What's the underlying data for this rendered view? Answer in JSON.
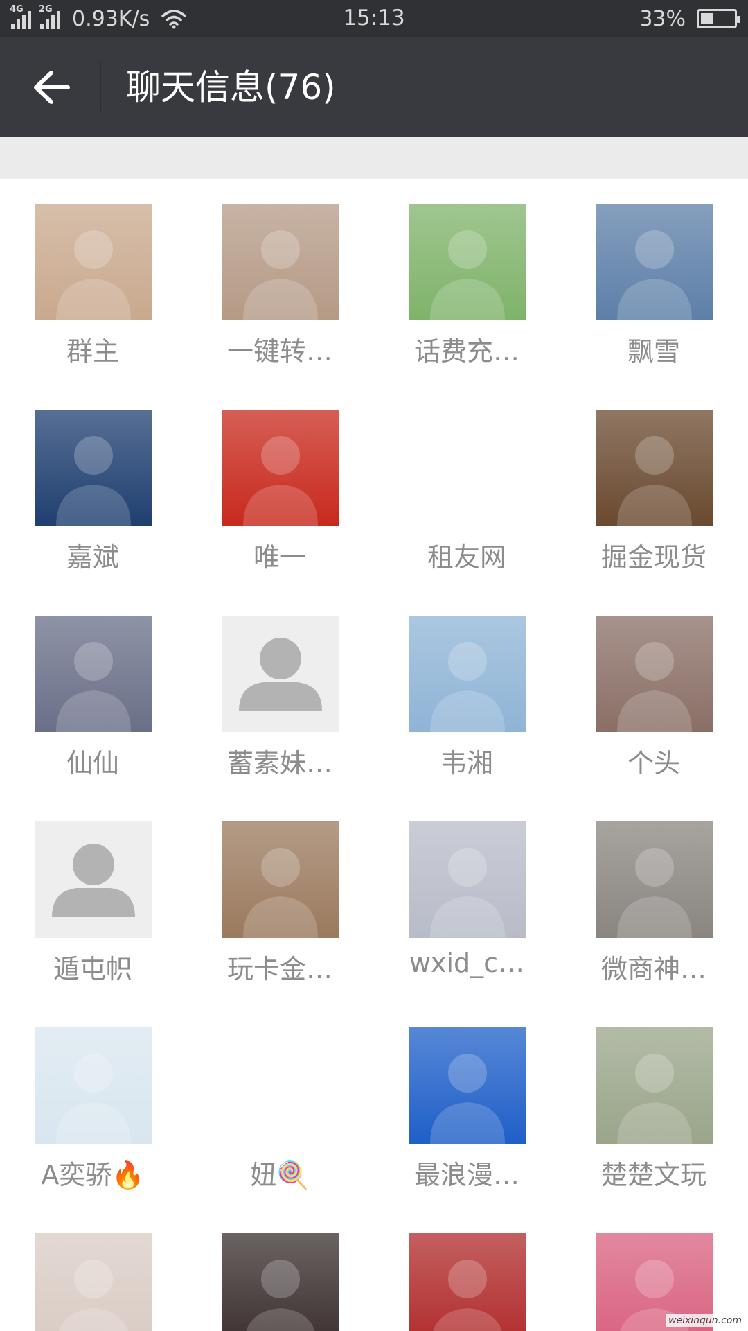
{
  "status_bar": {
    "net1": "4G",
    "net2": "2G",
    "speed": "0.93K/s",
    "time": "15:13",
    "battery_text": "33%",
    "battery_level": 0.33,
    "wifi_icon": "wifi-icon"
  },
  "header": {
    "title": "聊天信息(76)",
    "back_icon": "arrow-left-icon"
  },
  "members": [
    {
      "name": "群主",
      "color": "#c9a98e"
    },
    {
      "name": "一键转…",
      "color": "#b59a86"
    },
    {
      "name": "话费充…",
      "color": "#7fb36a"
    },
    {
      "name": "飘雪",
      "color": "#5d7fa8"
    },
    {
      "name": "嘉斌",
      "color": "#1f3f70"
    },
    {
      "name": "唯一",
      "color": "#c8291d"
    },
    {
      "name": "租友网",
      "color": "#ffffff"
    },
    {
      "name": "掘金现货",
      "color": "#6a4a30"
    },
    {
      "name": "仙仙",
      "color": "#6a6f88"
    },
    {
      "name": "蓄素妹…",
      "color": "#f0f0f0"
    },
    {
      "name": "韦湘",
      "color": "#8fb4d6"
    },
    {
      "name": "个头",
      "color": "#8a6f66"
    },
    {
      "name": "遁屯帜",
      "color": "#f0f0f0"
    },
    {
      "name": "玩卡金…",
      "color": "#9b7a5e"
    },
    {
      "name": "wxid_c…",
      "color": "#b8bcc8"
    },
    {
      "name": "微商神…",
      "color": "#8a8580"
    },
    {
      "name": "A奕骄🔥",
      "color": "#d9e6ef"
    },
    {
      "name": "妞🍭",
      "color": "#ffffff"
    },
    {
      "name": "最浪漫…",
      "color": "#1f5fc8"
    },
    {
      "name": "楚楚文玩",
      "color": "#9aa58a"
    },
    {
      "name": "",
      "color": "#d9cbc4"
    },
    {
      "name": "",
      "color": "#3a2e2e"
    },
    {
      "name": "",
      "color": "#b02a2a"
    },
    {
      "name": "",
      "color": "#d9607e"
    }
  ],
  "watermark": "weixinqun.com"
}
